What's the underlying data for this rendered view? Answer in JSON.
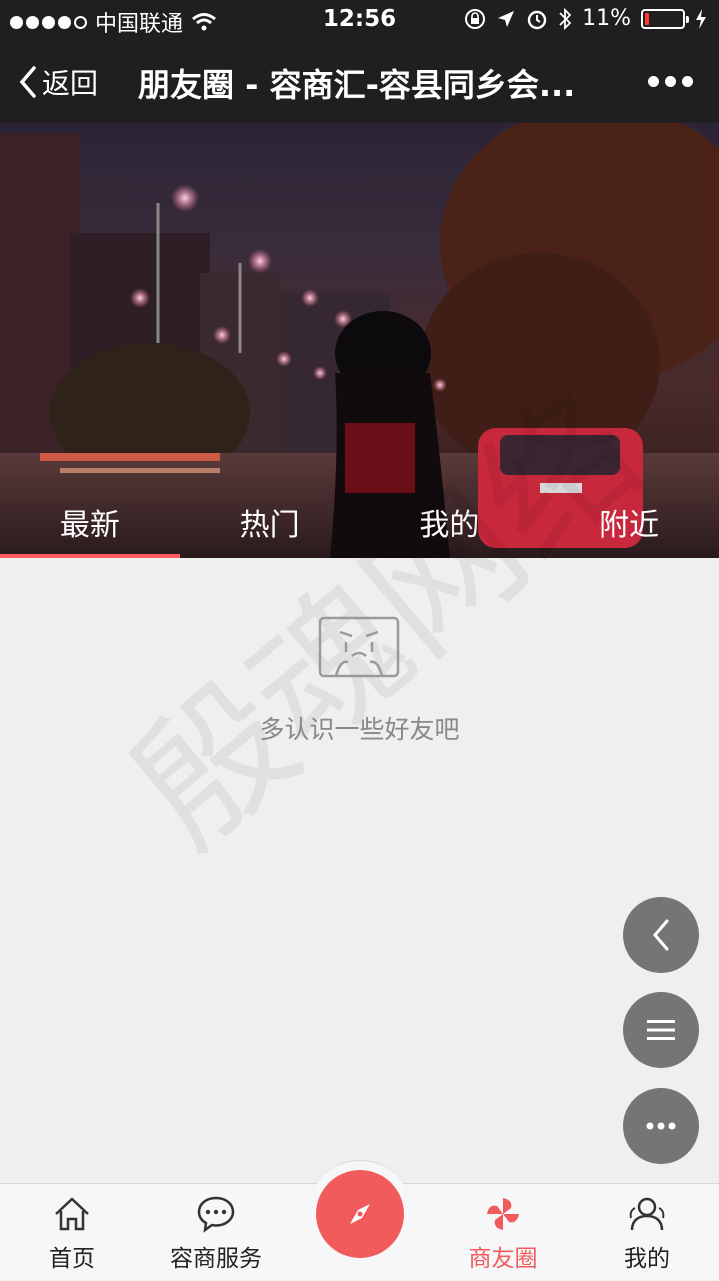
{
  "status_bar": {
    "carrier": "中国联通",
    "time": "12:56",
    "battery": "11%",
    "battery_level": 0.11
  },
  "nav": {
    "back_label": "返回",
    "title": "朋友圈 - 容商汇-容县同乡会..."
  },
  "tabs": [
    {
      "label": "最新",
      "active": true
    },
    {
      "label": "热门"
    },
    {
      "label": "我的"
    },
    {
      "label": "附近"
    }
  ],
  "empty_state": {
    "text": "多认识一些好友吧"
  },
  "watermark": "殷魂网络",
  "bottom_tabs": [
    {
      "label": "首页",
      "icon": "home-icon"
    },
    {
      "label": "容商服务",
      "icon": "chat-icon"
    },
    {
      "label": "",
      "icon": "compass-icon"
    },
    {
      "label": "商友圈",
      "icon": "pinwheel-icon",
      "active": true
    },
    {
      "label": "我的",
      "icon": "user-icon"
    }
  ],
  "colors": {
    "accent": "#f25b5b",
    "bar": "#1f1f21",
    "background": "#efeef1"
  }
}
